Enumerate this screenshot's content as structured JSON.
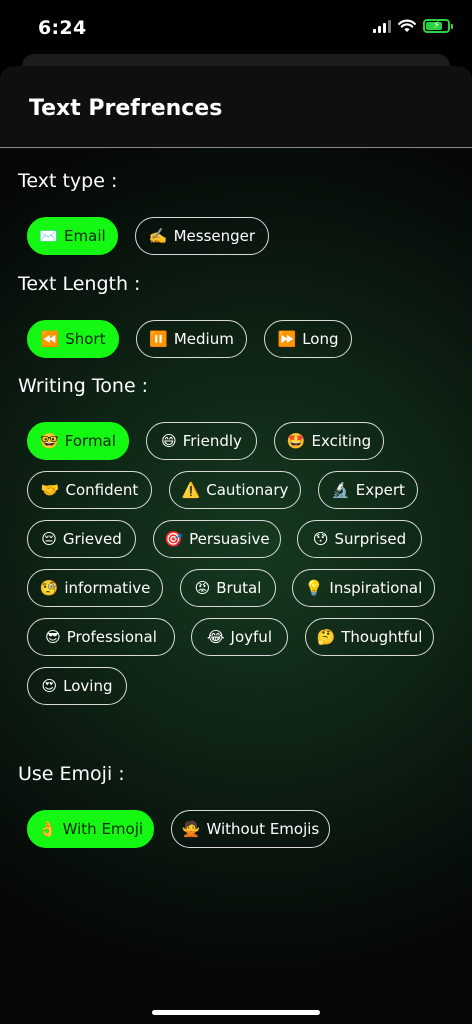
{
  "status_bar": {
    "time": "6:24"
  },
  "header": {
    "title": "Text Prefrences"
  },
  "sections": {
    "text_type": {
      "label": "Text type :"
    },
    "text_length": {
      "label": "Text Length :"
    },
    "writing_tone": {
      "label": "Writing Tone :"
    },
    "use_emoji": {
      "label": "Use Emoji :"
    }
  },
  "chips": {
    "email": {
      "emoji": "✉️",
      "label": "Email",
      "selected": true
    },
    "messenger": {
      "emoji": "✍️",
      "label": "Messenger",
      "selected": false
    },
    "short": {
      "emoji": "⏪",
      "label": "Short",
      "selected": true
    },
    "medium": {
      "emoji": "⏸️",
      "label": "Medium",
      "selected": false
    },
    "long": {
      "emoji": "⏩",
      "label": "Long",
      "selected": false
    },
    "formal": {
      "emoji": "🤓",
      "label": "Formal",
      "selected": true
    },
    "friendly": {
      "emoji": "😄",
      "label": "Friendly",
      "selected": false
    },
    "exciting": {
      "emoji": "🤩",
      "label": "Exciting",
      "selected": false
    },
    "confident": {
      "emoji": "🤝",
      "label": "Confident",
      "selected": false
    },
    "cautionary": {
      "emoji": "⚠️",
      "label": "Cautionary",
      "selected": false
    },
    "expert": {
      "emoji": "🔬",
      "label": "Expert",
      "selected": false
    },
    "grieved": {
      "emoji": "😔",
      "label": "Grieved",
      "selected": false
    },
    "persuasive": {
      "emoji": "🎯",
      "label": "Persuasive",
      "selected": false
    },
    "surprised": {
      "emoji": "😯",
      "label": "Surprised",
      "selected": false
    },
    "informative": {
      "emoji": "🧐",
      "label": "informative",
      "selected": false
    },
    "brutal": {
      "emoji": "😡",
      "label": "Brutal",
      "selected": false
    },
    "inspirational": {
      "emoji": "💡",
      "label": "Inspirational",
      "selected": false
    },
    "professional": {
      "emoji": "😎",
      "label": "Professional",
      "selected": false
    },
    "joyful": {
      "emoji": "😂",
      "label": "Joyful",
      "selected": false
    },
    "thoughtful": {
      "emoji": "🤔",
      "label": "Thoughtful",
      "selected": false
    },
    "loving": {
      "emoji": "😍",
      "label": "Loving",
      "selected": false
    },
    "with_emoji": {
      "emoji": "👌",
      "label": "With Emoji",
      "selected": true
    },
    "without_emojis": {
      "emoji": "🙅",
      "label": "Without Emojis",
      "selected": false
    }
  },
  "colors": {
    "accent": "#14f814",
    "border": "#d9d9d9",
    "background": "#0e2414"
  }
}
